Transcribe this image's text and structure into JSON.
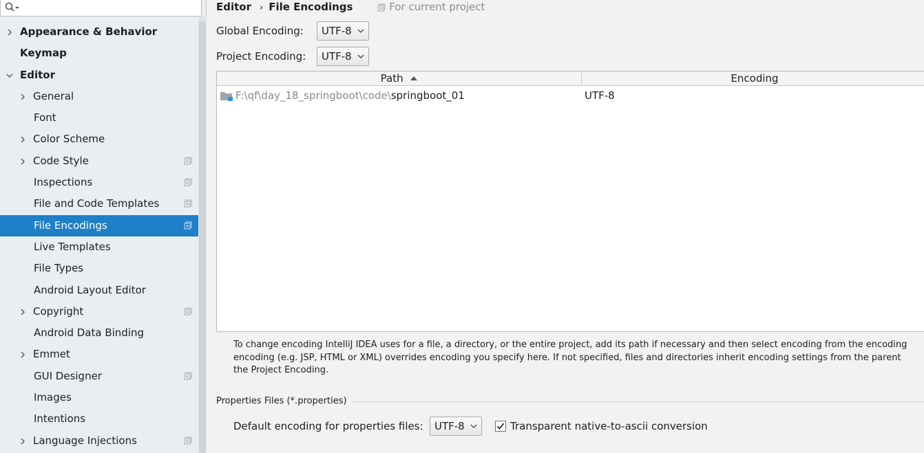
{
  "sidebar": {
    "search": {
      "placeholder": "",
      "value": ""
    },
    "items": [
      {
        "label": "Appearance & Behavior",
        "level": 0,
        "chevron": "right",
        "project_icon": false
      },
      {
        "label": "Keymap",
        "level": 0,
        "chevron": "none",
        "project_icon": false
      },
      {
        "label": "Editor",
        "level": 0,
        "chevron": "down",
        "project_icon": false
      },
      {
        "label": "General",
        "level": 1,
        "chevron": "right",
        "project_icon": false
      },
      {
        "label": "Font",
        "level": 1,
        "chevron": "none",
        "project_icon": false
      },
      {
        "label": "Color Scheme",
        "level": 1,
        "chevron": "right",
        "project_icon": false
      },
      {
        "label": "Code Style",
        "level": 1,
        "chevron": "right",
        "project_icon": true
      },
      {
        "label": "Inspections",
        "level": 1,
        "chevron": "none",
        "project_icon": true
      },
      {
        "label": "File and Code Templates",
        "level": 1,
        "chevron": "none",
        "project_icon": true
      },
      {
        "label": "File Encodings",
        "level": 1,
        "chevron": "none",
        "project_icon": true,
        "selected": true
      },
      {
        "label": "Live Templates",
        "level": 1,
        "chevron": "none",
        "project_icon": false
      },
      {
        "label": "File Types",
        "level": 1,
        "chevron": "none",
        "project_icon": false
      },
      {
        "label": "Android Layout Editor",
        "level": 1,
        "chevron": "none",
        "project_icon": false
      },
      {
        "label": "Copyright",
        "level": 1,
        "chevron": "right",
        "project_icon": true
      },
      {
        "label": "Android Data Binding",
        "level": 1,
        "chevron": "none",
        "project_icon": false
      },
      {
        "label": "Emmet",
        "level": 1,
        "chevron": "right",
        "project_icon": false
      },
      {
        "label": "GUI Designer",
        "level": 1,
        "chevron": "none",
        "project_icon": true
      },
      {
        "label": "Images",
        "level": 1,
        "chevron": "none",
        "project_icon": false
      },
      {
        "label": "Intentions",
        "level": 1,
        "chevron": "none",
        "project_icon": false
      },
      {
        "label": "Language Injections",
        "level": 1,
        "chevron": "right",
        "project_icon": true
      }
    ]
  },
  "breadcrumb": {
    "parent": "Editor",
    "current": "File Encodings",
    "scope": "For current project"
  },
  "global_encoding": {
    "label": "Global Encoding:",
    "value": "UTF-8"
  },
  "project_encoding": {
    "label": "Project Encoding:",
    "value": "UTF-8"
  },
  "table": {
    "columns": {
      "path": "Path",
      "encoding": "Encoding"
    },
    "sort_column": "Path",
    "sort_direction": "ascending",
    "rows": [
      {
        "path_prefix": "F:\\qf\\day_18_springboot\\code\\",
        "path_name": "springboot_01",
        "encoding": "UTF-8"
      }
    ]
  },
  "hint": {
    "line1": "To change encoding IntelliJ IDEA uses for a file, a directory, or the entire project, add its path if necessary and then select encoding from the encoding",
    "line2": "encoding (e.g. JSP, HTML or XML) overrides encoding you specify here. If not specified, files and directories inherit encoding settings from the parent",
    "line3": "the Project Encoding."
  },
  "properties": {
    "section_title": "Properties Files (*.properties)",
    "default_label": "Default encoding for properties files:",
    "default_value": "UTF-8",
    "native_to_ascii_label": "Transparent native-to-ascii conversion",
    "native_to_ascii_checked": true
  },
  "colors": {
    "selection": "#1f7fc8",
    "sidebar_bg": "#e9eef3",
    "panel_bg": "#f2f2f2"
  }
}
